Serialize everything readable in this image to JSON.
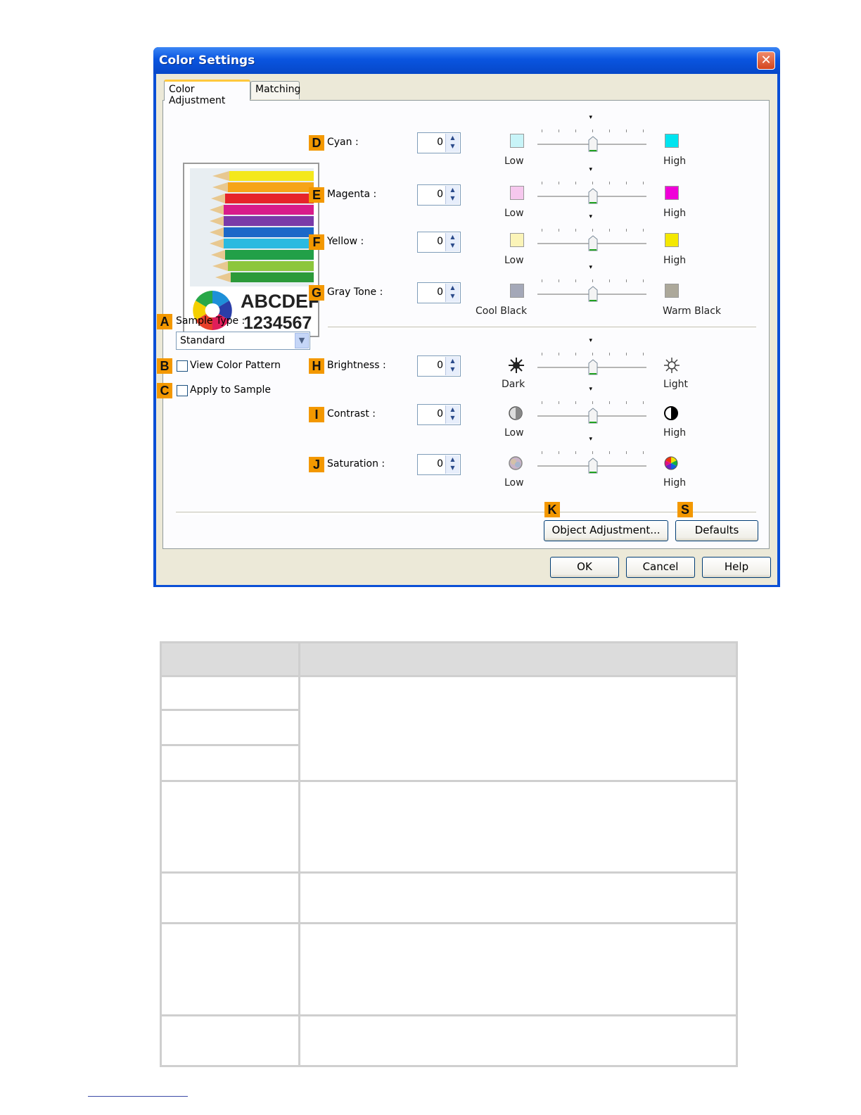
{
  "window": {
    "title": "Color Settings",
    "close_glyph": "✕",
    "tabs": [
      {
        "label": "Color Adjustment",
        "active": true
      },
      {
        "label": "Matching",
        "active": false
      }
    ]
  },
  "sample_image": {
    "text_line1": "ABCDEF",
    "text_line2": "1234567"
  },
  "sample_type": {
    "badge": "A",
    "label": "Sample Type :",
    "selected": "Standard"
  },
  "view_color_pattern": {
    "badge": "B",
    "label": "View Color Pattern",
    "checked": false
  },
  "apply_to_sample": {
    "badge": "C",
    "label": "Apply to Sample",
    "checked": false
  },
  "color_sliders": [
    {
      "badge": "D",
      "label": "Cyan :",
      "value": "0",
      "low_label": "Low",
      "high_label": "High",
      "low_color": "#c8f4f8",
      "high_color": "#00e4f0",
      "level": 0.5
    },
    {
      "badge": "E",
      "label": "Magenta :",
      "value": "0",
      "low_label": "Low",
      "high_label": "High",
      "low_color": "#f6c8ee",
      "high_color": "#f000d8",
      "level": 0.5
    },
    {
      "badge": "F",
      "label": "Yellow :",
      "value": "0",
      "low_label": "Low",
      "high_label": "High",
      "low_color": "#fbf4b8",
      "high_color": "#f4e800",
      "level": 0.5
    },
    {
      "badge": "G",
      "label": "Gray Tone :",
      "value": "0",
      "low_label": "Cool Black",
      "high_label": "Warm Black",
      "low_color": "#a4a8b8",
      "high_color": "#aca89a",
      "level": 0.5
    }
  ],
  "image_sliders": [
    {
      "badge": "H",
      "label": "Brightness :",
      "value": "0",
      "low_label": "Dark",
      "high_label": "Light",
      "low_icon": "sun-dark-icon",
      "high_icon": "sun-light-icon",
      "level": 0.5
    },
    {
      "badge": "I",
      "label": "Contrast :",
      "value": "0",
      "low_label": "Low",
      "high_label": "High",
      "low_icon": "contrast-low-icon",
      "high_icon": "contrast-high-icon",
      "level": 0.5
    },
    {
      "badge": "J",
      "label": "Saturation :",
      "value": "0",
      "low_label": "Low",
      "high_label": "High",
      "low_icon": "saturation-low-icon",
      "high_icon": "saturation-high-icon",
      "level": 0.5
    }
  ],
  "object_adjustment": {
    "badge": "K",
    "label": "Object Adjustment..."
  },
  "defaults": {
    "badge": "S",
    "label": "Defaults"
  },
  "footer_buttons": {
    "ok": "OK",
    "cancel": "Cancel",
    "help": "Help"
  }
}
